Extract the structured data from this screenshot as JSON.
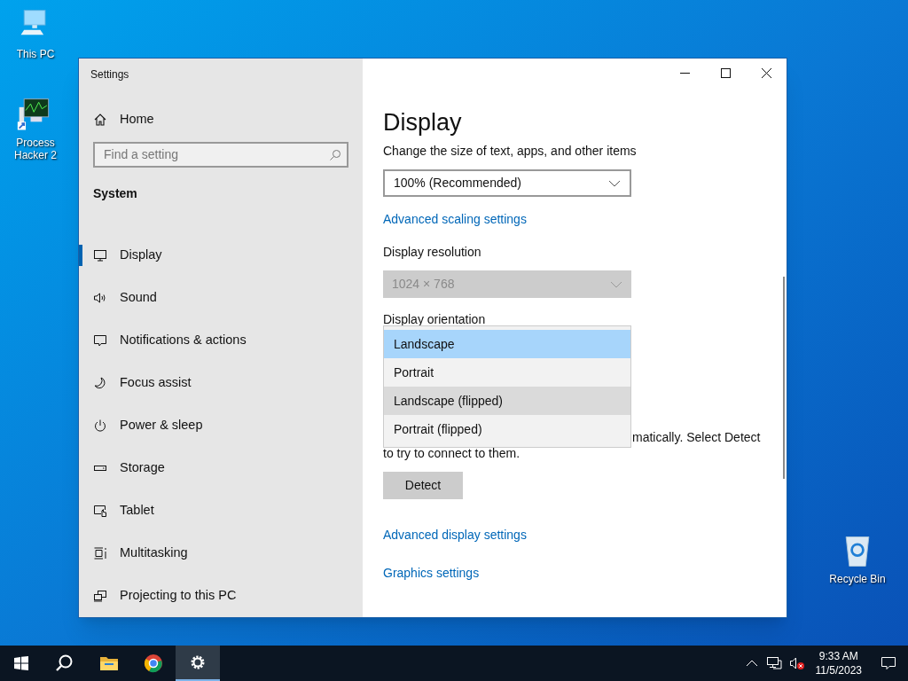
{
  "desktop_icons": [
    {
      "kind": "pc",
      "label": "This PC"
    },
    {
      "kind": "app",
      "label": "Process Hacker 2"
    },
    {
      "kind": "bin",
      "label": "Recycle Bin"
    }
  ],
  "window": {
    "title": "Settings",
    "sidebar": {
      "home": "Home",
      "search": {
        "placeholder": "Find a setting"
      },
      "section": "System",
      "items": [
        {
          "kind": "display",
          "label": "Display",
          "selected": true
        },
        {
          "kind": "sound",
          "label": "Sound",
          "selected": false
        },
        {
          "kind": "notifications",
          "label": "Notifications & actions",
          "selected": false
        },
        {
          "kind": "focus",
          "label": "Focus assist",
          "selected": false
        },
        {
          "kind": "power",
          "label": "Power & sleep",
          "selected": false
        },
        {
          "kind": "storage",
          "label": "Storage",
          "selected": false
        },
        {
          "kind": "tablet",
          "label": "Tablet",
          "selected": false
        },
        {
          "kind": "multitasking",
          "label": "Multitasking",
          "selected": false
        },
        {
          "kind": "projecting",
          "label": "Projecting to this PC",
          "selected": false
        }
      ]
    },
    "content": {
      "heading": "Display",
      "scale": {
        "label": "Change the size of text, apps, and other items",
        "value": "100% (Recommended)",
        "disabled": false
      },
      "scale_link": "Advanced scaling settings",
      "resolution": {
        "label": "Display resolution",
        "value": "1024 × 768",
        "disabled": true
      },
      "orientation": {
        "label": "Display orientation",
        "options": [
          {
            "label": "Landscape",
            "selected": true,
            "hovered": false
          },
          {
            "label": "Portrait",
            "selected": false,
            "hovered": false
          },
          {
            "label": "Landscape (flipped)",
            "selected": false,
            "hovered": true
          },
          {
            "label": "Portrait (flipped)",
            "selected": false,
            "hovered": false
          }
        ]
      },
      "detect_text": [
        "matically. Select Detect",
        "to try to connect to them."
      ],
      "detect_button": "Detect",
      "links": [
        "Advanced display settings",
        "Graphics settings"
      ]
    }
  },
  "taskbar": {
    "apps": [
      {
        "kind": "search",
        "selected": false
      },
      {
        "kind": "folder",
        "selected": false
      },
      {
        "kind": "browser",
        "selected": false
      },
      {
        "kind": "settings",
        "selected": true
      }
    ],
    "time": "9:33 AM",
    "date": "11/5/2023"
  }
}
